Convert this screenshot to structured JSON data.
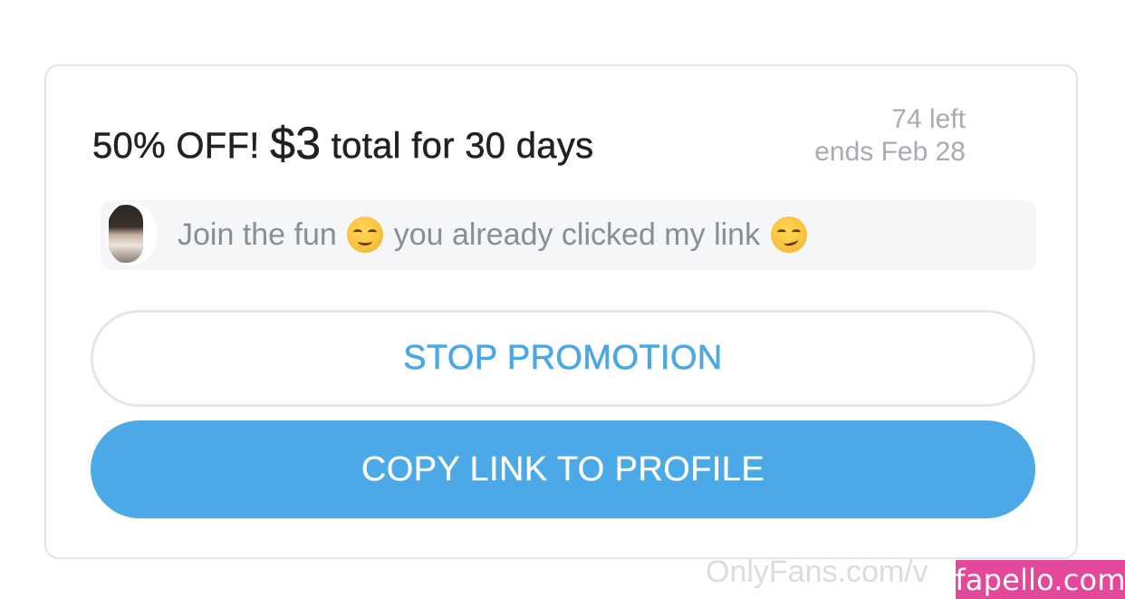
{
  "promotion": {
    "headline_prefix": "50% OFF!",
    "headline_price": "$3",
    "headline_suffix": "total for 30 days",
    "remaining": "74 left",
    "ends": "ends Feb 28",
    "message_part1": "Join the fun",
    "message_part2": "you already clicked my link",
    "emoji_1": "relieved-face",
    "emoji_2": "smirking-face"
  },
  "actions": {
    "stop_label": "STOP PROMOTION",
    "copy_label": "COPY LINK TO PROFILE"
  },
  "watermark": {
    "site_text": "OnlyFans.com/v",
    "badge_text": "fapello.com"
  },
  "colors": {
    "accent": "#4aa9e6",
    "badge": "#e3489a"
  }
}
